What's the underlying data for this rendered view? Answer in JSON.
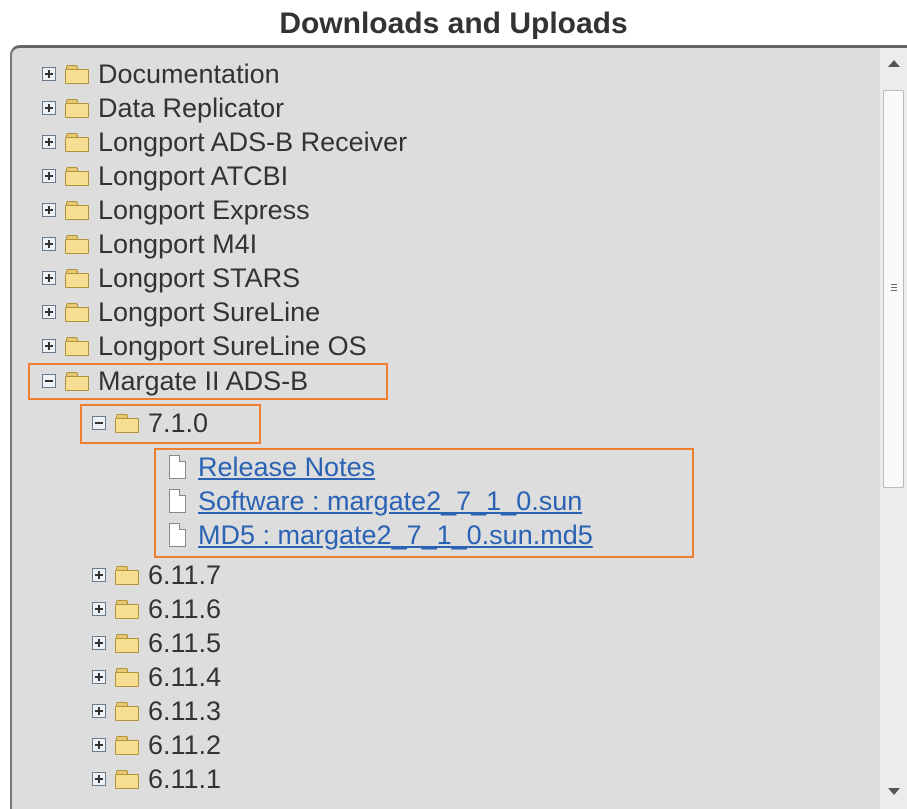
{
  "title": "Downloads and Uploads",
  "tree": [
    {
      "label": "Documentation",
      "state": "collapsed"
    },
    {
      "label": "Data Replicator",
      "state": "collapsed"
    },
    {
      "label": "Longport ADS-B Receiver",
      "state": "collapsed"
    },
    {
      "label": "Longport ATCBI",
      "state": "collapsed"
    },
    {
      "label": "Longport Express",
      "state": "collapsed"
    },
    {
      "label": "Longport M4I",
      "state": "collapsed"
    },
    {
      "label": "Longport STARS",
      "state": "collapsed"
    },
    {
      "label": "Longport SureLine",
      "state": "collapsed"
    },
    {
      "label": "Longport SureLine OS",
      "state": "collapsed"
    },
    {
      "label": "Margate II ADS-B",
      "state": "expanded",
      "children": [
        {
          "label": "7.1.0",
          "state": "expanded",
          "files": [
            "Release Notes",
            "Software : margate2_7_1_0.sun",
            "MD5 : margate2_7_1_0.sun.md5"
          ]
        },
        {
          "label": "6.11.7",
          "state": "collapsed"
        },
        {
          "label": "6.11.6",
          "state": "collapsed"
        },
        {
          "label": "6.11.5",
          "state": "collapsed"
        },
        {
          "label": "6.11.4",
          "state": "collapsed"
        },
        {
          "label": "6.11.3",
          "state": "collapsed"
        },
        {
          "label": "6.11.2",
          "state": "collapsed"
        },
        {
          "label": "6.11.1",
          "state": "collapsed"
        }
      ]
    }
  ],
  "highlight_color": "#f08030",
  "link_color": "#2a62b4"
}
